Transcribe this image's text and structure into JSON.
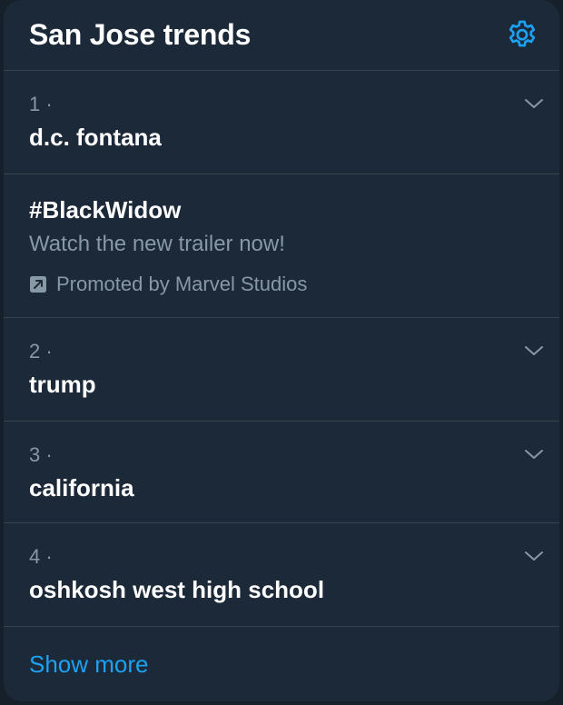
{
  "header": {
    "title": "San Jose trends",
    "settings_icon": "gear-icon"
  },
  "trends": [
    {
      "rank": "1 ·",
      "name": "d.c. fontana"
    },
    {
      "rank": "2 ·",
      "name": "trump"
    },
    {
      "rank": "3 ·",
      "name": "california"
    },
    {
      "rank": "4 ·",
      "name": "oshkosh west high school"
    }
  ],
  "promoted": {
    "name": "#BlackWidow",
    "description": "Watch the new trailer now!",
    "label": "Promoted by Marvel Studios",
    "icon": "promoted-icon"
  },
  "footer": {
    "show_more": "Show more"
  },
  "colors": {
    "background": "#15202b",
    "panel": "#1c2938",
    "divider": "#38444d",
    "secondary_text": "#8899a6",
    "accent": "#1da1f2"
  }
}
